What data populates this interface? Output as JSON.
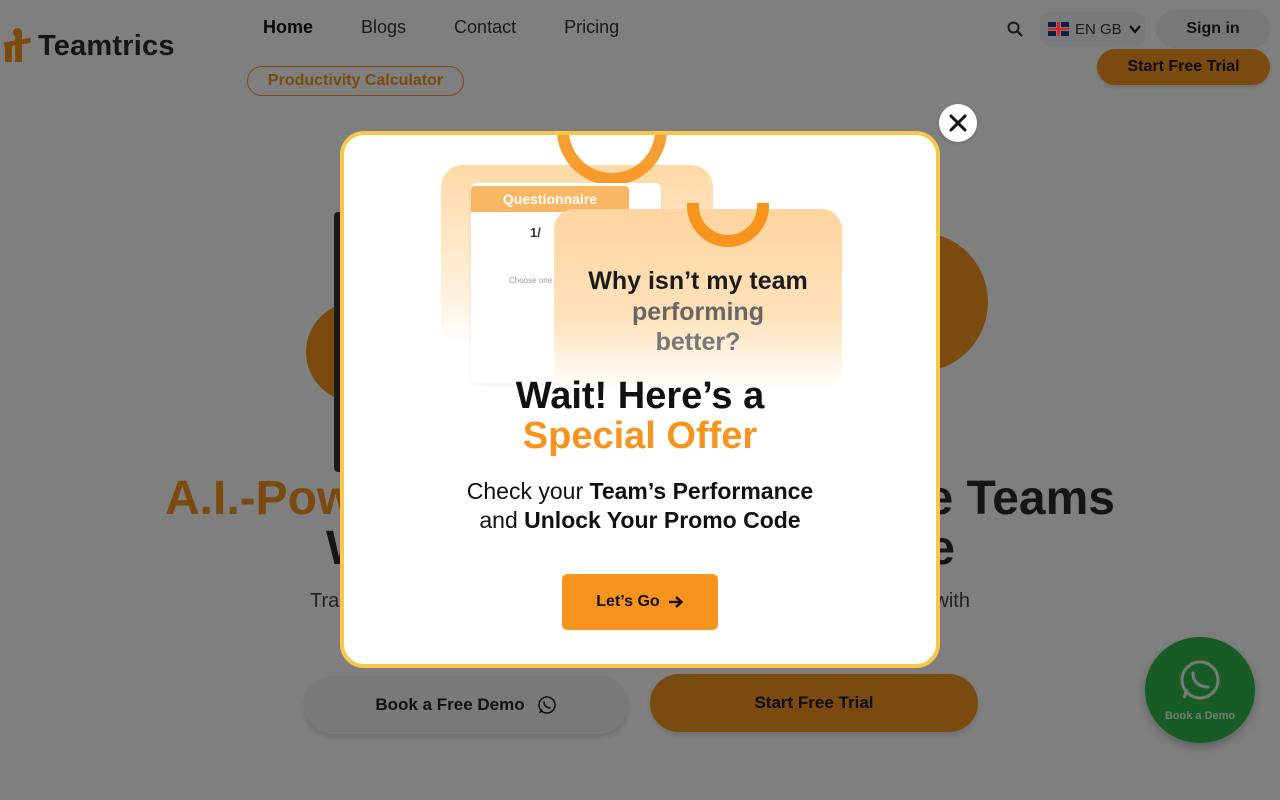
{
  "header": {
    "brand": "Teamtrics",
    "nav": [
      "Home",
      "Blogs",
      "Contact",
      "Pricing"
    ],
    "calculator_label": "Productivity Calculator",
    "language_label": "EN GB",
    "signin_label": "Sign in",
    "trial_label": "Start Free Trial"
  },
  "hero": {
    "title_line1_left": "A.I.-Pow",
    "title_line1_right": "e Teams",
    "title_line2_left": "W",
    "title_line2_right": "e",
    "subtitle_left": "Tra",
    "subtitle_right": "with",
    "demo_label": "Book a Free Demo",
    "trial_label": "Start Free Trial"
  },
  "whatsapp": {
    "label": "Book a Demo"
  },
  "modal": {
    "illustration": {
      "tab": "Questionnaire",
      "counter": "1/",
      "choose": "Choose one",
      "q1": "Why isn’t my team",
      "q2": "performing",
      "q3": "better?"
    },
    "title_line1": "Wait! Here’s a",
    "title_line2": "Special Offer",
    "sub1_plain": "Check your ",
    "sub1_bold": "Team’s Performance",
    "sub2_plain": "and ",
    "sub2_bold": "Unlock Your Promo Code",
    "cta_label": "Let’s Go"
  },
  "colors": {
    "accent": "#f7941d",
    "modal_border": "#f7c84b",
    "whatsapp": "#2fb64b"
  }
}
